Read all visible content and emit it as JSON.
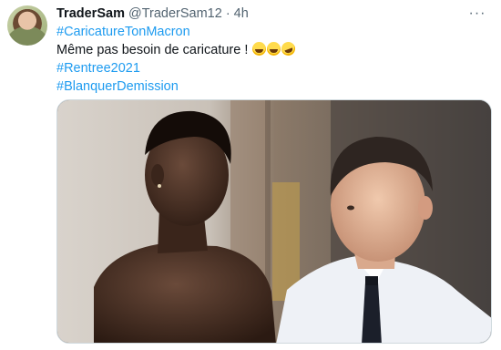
{
  "tweet": {
    "display_name": "TraderSam",
    "handle": "@TraderSam12",
    "separator": "·",
    "time": "4h",
    "more_label": "···",
    "lines": {
      "hashtag1": "#CaricatureTonMacron",
      "text": "Même pas besoin de caricature !",
      "hashtag2": "#Rentree2021",
      "hashtag3": "#BlanquerDemission"
    },
    "emojis": [
      "face-with-tears-of-joy",
      "face-with-tears-of-joy",
      "rolling-on-the-floor-laughing"
    ]
  },
  "colors": {
    "hashtag": "#1d9bf0",
    "text": "#0f1419",
    "secondary": "#536471",
    "border": "#cfd9de"
  }
}
